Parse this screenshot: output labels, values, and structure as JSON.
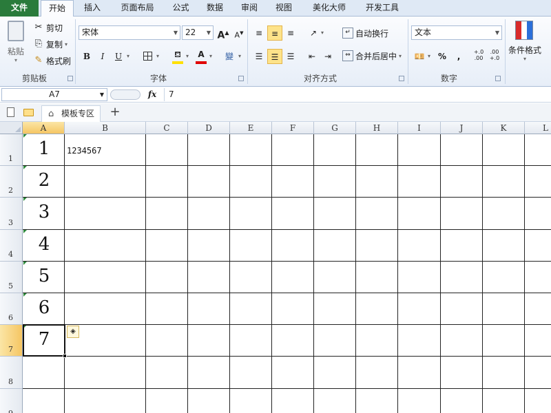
{
  "tabs": [
    "文件",
    "开始",
    "插入",
    "页面布局",
    "公式",
    "数据",
    "审阅",
    "视图",
    "美化大师",
    "开发工具"
  ],
  "clipboard": {
    "paste": "粘贴",
    "cut": "剪切",
    "copy": "复制",
    "format_painter": "格式刷",
    "label": "剪贴板"
  },
  "font": {
    "name": "宋体",
    "size": "22",
    "label": "字体",
    "bold": "B",
    "italic": "I",
    "underline": "U",
    "grow": "A",
    "shrink": "A",
    "wen": "變"
  },
  "align": {
    "wrap": "自动换行",
    "merge": "合并后居中",
    "label": "对齐方式"
  },
  "number": {
    "format": "文本",
    "label": "数字",
    "percent": "%",
    "comma": ",",
    "inc": "+.0\n.00",
    "dec": ".00\n+.0"
  },
  "styles": {
    "conditional": "条件格式"
  },
  "formula_bar": {
    "cell_ref": "A7",
    "fx": "fx",
    "value": "7"
  },
  "doc_tabs": {
    "template": "模板专区",
    "add": "+"
  },
  "columns": [
    "A",
    "B",
    "C",
    "D",
    "E",
    "F",
    "G",
    "H",
    "I",
    "J",
    "K",
    "L"
  ],
  "rows": [
    "1",
    "2",
    "3",
    "4",
    "5",
    "6",
    "7",
    "8",
    "9"
  ],
  "cells": {
    "A": [
      "1",
      "2",
      "3",
      "4",
      "5",
      "6",
      "7"
    ],
    "B1": "1234567"
  },
  "selected_cell": "A7",
  "colors": {
    "ribbon_bg": "#dfe9f5",
    "file_tab": "#2a7b3b",
    "selection_header": "#f5c563"
  }
}
